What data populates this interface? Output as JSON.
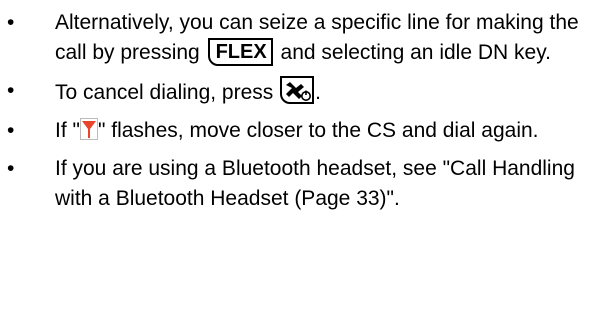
{
  "items": [
    {
      "bullet": "•",
      "text_a": "Alternatively, you can seize a specific line for making the call by pressing ",
      "key": "FLEX",
      "text_b": " and selecting an idle DN key."
    },
    {
      "bullet": "•",
      "text_a": "To cancel dialing, press ",
      "key_icon": "end-call-power-key-icon",
      "text_b": "."
    },
    {
      "bullet": "•",
      "text_a": "If \"",
      "icon": "antenna-signal-icon",
      "text_b": "\" flashes, move closer to the CS and dial again."
    },
    {
      "bullet": "•",
      "text": "If you are using a Bluetooth headset, see \"Call Handling with a Bluetooth Headset (Page 33)\"."
    }
  ],
  "colors": {
    "text": "#000000",
    "antenna_icon": "#e8452b"
  }
}
